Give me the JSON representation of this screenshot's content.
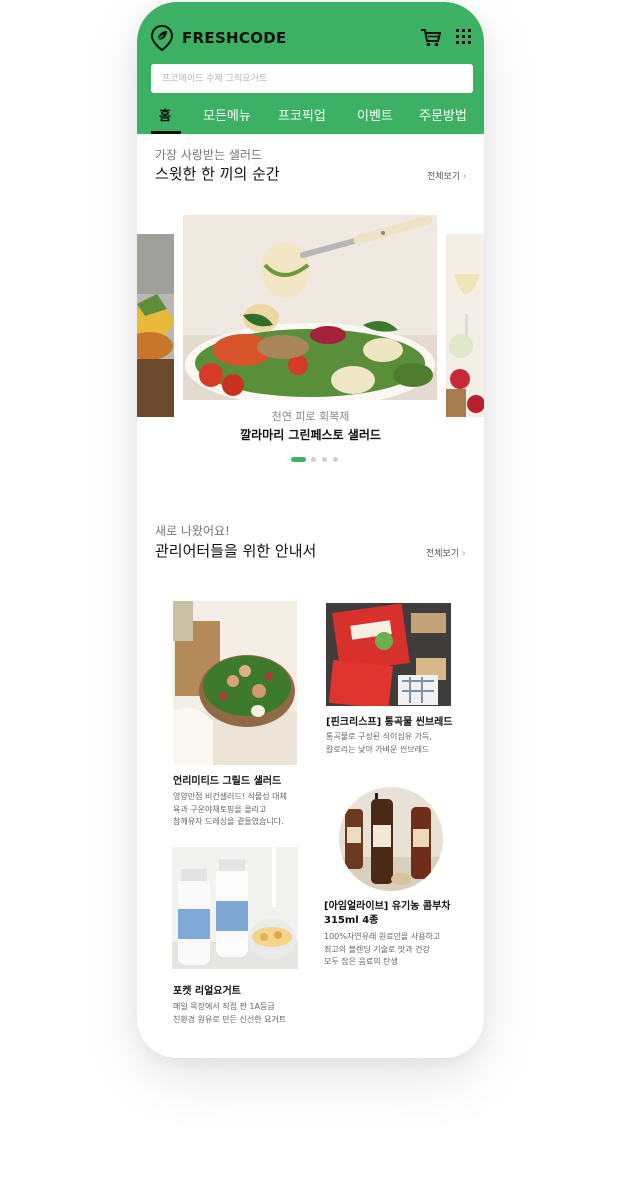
{
  "header": {
    "brand": "FRESHCODE",
    "search_placeholder": "프코메이드 수제 그릭요거트",
    "tabs": [
      {
        "label": "홈",
        "active": true
      },
      {
        "label": "모든메뉴",
        "active": false
      },
      {
        "label": "프코픽업",
        "active": false
      },
      {
        "label": "이벤트",
        "active": false
      },
      {
        "label": "주문방법",
        "active": false
      }
    ],
    "icons": {
      "logo": "leaf-pin-icon",
      "cart": "cart-icon",
      "menu": "grid-menu-icon"
    }
  },
  "colors": {
    "brand_green": "#3cb063",
    "text_dark": "#111111",
    "text_muted": "#777777"
  },
  "section_popular": {
    "subtitle": "가장 사랑받는 샐러드",
    "title": "스윗한 한 끼의 순간",
    "more_label": "전체보기",
    "slide": {
      "subtitle": "천연 피로 회복제",
      "title": "깔라마리 그린페스토 샐러드"
    },
    "slide_count": 4,
    "active_slide": 1
  },
  "section_new": {
    "subtitle": "새로 나왔어요!",
    "title": "관리어터들을 위한 안내서",
    "more_label": "전체보기",
    "cards": [
      {
        "title": "언리미티드 그릴드 샐러드",
        "desc": [
          "영양만점 비건샐러드! 식물성 대체",
          "육과 구운야채토핑을 올리고",
          "참깨유자 드레싱을 곁들였습니다."
        ]
      },
      {
        "title": "[핀크리스프] 통곡물 씬브레드",
        "desc": [
          "통곡물로 구성된 식이섬유 가득,",
          "칼로리는 낮아 가벼운 씬브레드"
        ]
      },
      {
        "title_lines": [
          "[아임얼라이브] 유기농 콤부차",
          "315ml 4종"
        ],
        "desc": [
          "100%자연유래 원료만을 사용하고",
          "최고의 블렌딩 기술로 맛과 건강",
          "모두 잡은 음료의 탄생"
        ]
      },
      {
        "title": "포켓 리얼요거트",
        "desc": [
          "매일 목장에서 직접 짠 1A등급",
          "친환경 원유로 만든 신선한 요거트"
        ]
      }
    ]
  }
}
